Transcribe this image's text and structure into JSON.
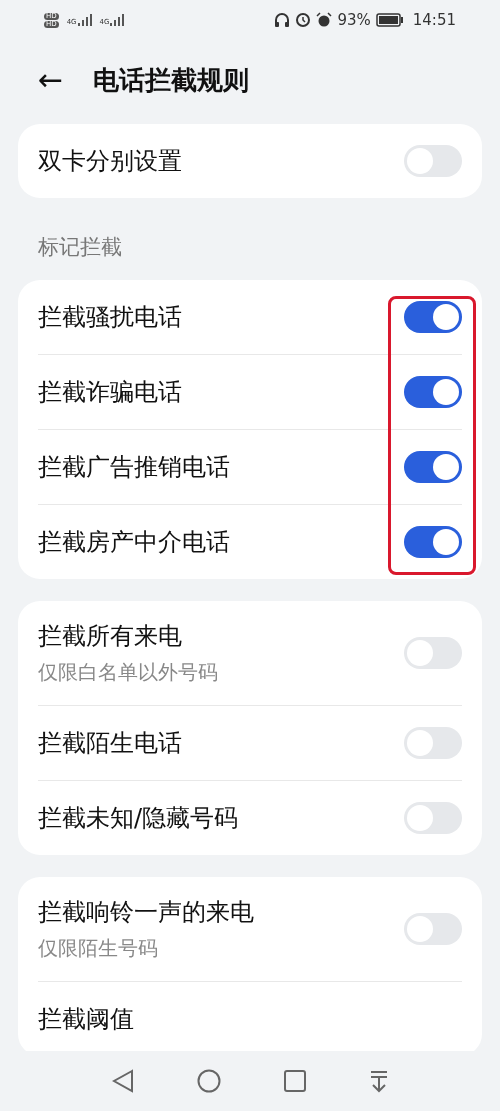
{
  "status_bar": {
    "sim_labels": [
      "HD",
      "HD"
    ],
    "network": [
      "4G",
      "4G"
    ],
    "battery": "93%",
    "time": "14:51"
  },
  "header": {
    "back": "←",
    "title": "电话拦截规则"
  },
  "groups": [
    {
      "highlighted": false,
      "rows": [
        {
          "title": "双卡分别设置",
          "on": false
        }
      ]
    },
    {
      "label": "标记拦截",
      "highlighted": true,
      "rows": [
        {
          "title": "拦截骚扰电话",
          "on": true
        },
        {
          "title": "拦截诈骗电话",
          "on": true
        },
        {
          "title": "拦截广告推销电话",
          "on": true
        },
        {
          "title": "拦截房产中介电话",
          "on": true
        }
      ]
    },
    {
      "highlighted": false,
      "rows": [
        {
          "title": "拦截所有来电",
          "subtitle": "仅限白名单以外号码",
          "on": false
        },
        {
          "title": "拦截陌生电话",
          "on": false
        },
        {
          "title": "拦截未知/隐藏号码",
          "on": false
        }
      ]
    },
    {
      "highlighted": false,
      "rows": [
        {
          "title": "拦截响铃一声的来电",
          "subtitle": "仅限陌生号码",
          "on": false
        },
        {
          "title": "拦截阈值"
        }
      ]
    }
  ]
}
